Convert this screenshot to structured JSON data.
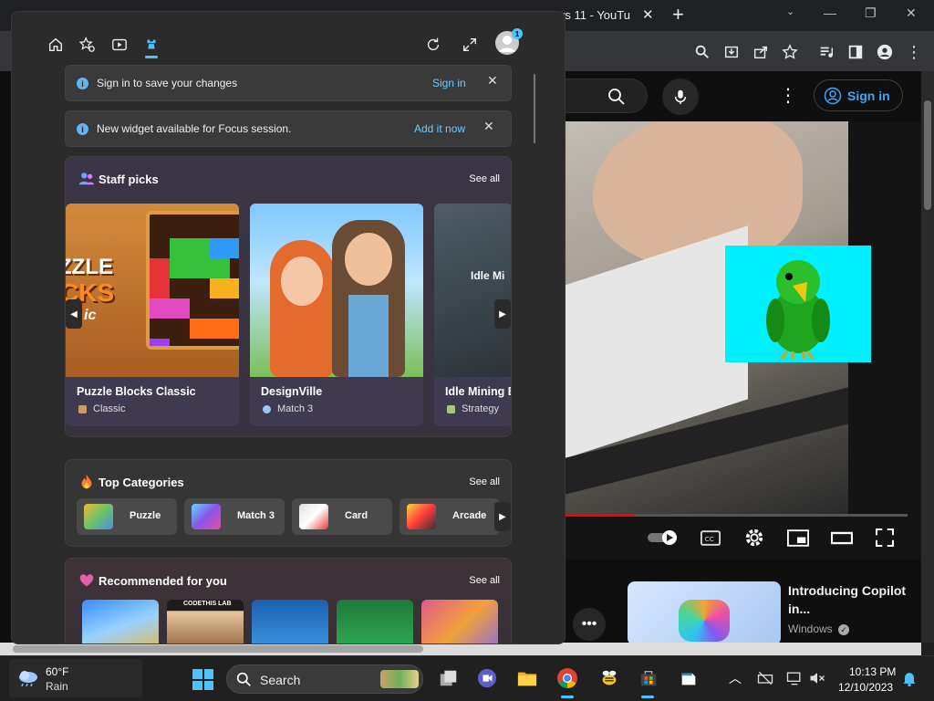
{
  "browser": {
    "tab_title": "ws 11 - YouTu",
    "tab_close": "✕",
    "new_tab": "+",
    "window_minimize": "—",
    "window_restore": "❐",
    "window_close": "✕"
  },
  "youtube": {
    "sign_in_label": "Sign in",
    "kebab": "⋮",
    "recommended_title": "Introducing Copilot in...",
    "recommended_channel": "Windows",
    "progress": 0.2,
    "more": "•••"
  },
  "widgets": {
    "notices": [
      {
        "message": "Sign in to save your changes",
        "action": "Sign in"
      },
      {
        "message": "New widget available for Focus session.",
        "action": "Add it now"
      }
    ],
    "staff_picks": {
      "title": "Staff picks",
      "see_all": "See all",
      "games": [
        {
          "name": "Puzzle Blocks Classic",
          "category": "Classic",
          "art_text_1": "ZZLE",
          "art_text_2": "CKS",
          "art_text_3": "ic"
        },
        {
          "name": "DesignVille",
          "category": "Match 3"
        },
        {
          "name": "Idle Mining E",
          "category": "Strategy",
          "art_text": "Idle Mi"
        }
      ]
    },
    "top_categories": {
      "title": "Top Categories",
      "see_all": "See all",
      "items": [
        "Puzzle",
        "Match 3",
        "Card",
        "Arcade"
      ]
    },
    "recommended": {
      "title": "Recommended for you",
      "see_all": "See all",
      "tile_2_caption": "CODETHIS LAB"
    },
    "arrow_left": "◀",
    "arrow_right": "▶",
    "avatar_badge": "1",
    "colors": {
      "accent": "#4cc2ff",
      "link": "#6ccbff"
    }
  },
  "taskbar": {
    "temperature": "60°F",
    "condition": "Rain",
    "search_label": "Search",
    "time": "10:13 PM",
    "date": "12/10/2023"
  }
}
